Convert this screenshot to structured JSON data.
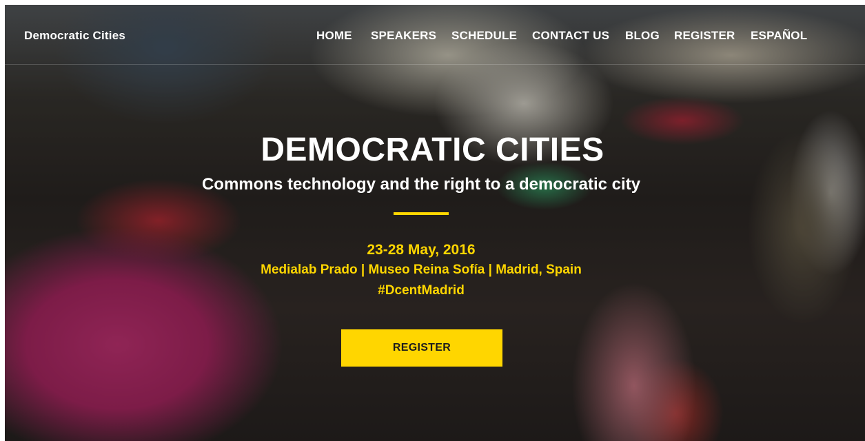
{
  "header": {
    "brand": "Democratic Cities",
    "nav": [
      {
        "label": "HOME"
      },
      {
        "label": "SPEAKERS"
      },
      {
        "label": "SCHEDULE"
      },
      {
        "label": "CONTACT US"
      },
      {
        "label": "BLOG"
      },
      {
        "label": "REGISTER"
      },
      {
        "label": "ESPAÑOL"
      }
    ]
  },
  "hero": {
    "title": "DEMOCRATIC CITIES",
    "subtitle": "Commons technology and the right to a democratic city",
    "date": "23-28 May, 2016",
    "venue": "Medialab Prado | Museo Reina Sofía | Madrid, Spain",
    "hashtag": "#DcentMadrid",
    "cta_label": "REGISTER"
  },
  "colors": {
    "accent": "#ffd600",
    "text_light": "#ffffff",
    "button_text": "#1c1c1c"
  }
}
